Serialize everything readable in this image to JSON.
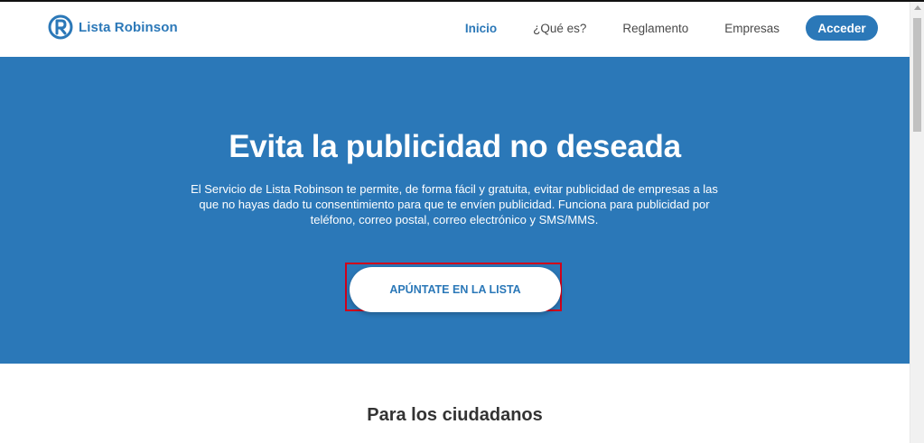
{
  "brand": {
    "name": "Lista Robinson",
    "color": "#2b78b8"
  },
  "nav": {
    "items": [
      {
        "label": "Inicio",
        "active": true
      },
      {
        "label": "¿Qué es?",
        "active": false
      },
      {
        "label": "Reglamento",
        "active": false
      },
      {
        "label": "Empresas",
        "active": false
      }
    ],
    "login_label": "Acceder"
  },
  "hero": {
    "title": "Evita la publicidad no deseada",
    "description": "El Servicio de Lista Robinson te permite, de forma fácil y gratuita, evitar publicidad de empresas a las que no hayas dado tu consentimiento para que te envíen publicidad. Funciona para publicidad por teléfono, correo postal, correo electrónico y SMS/MMS.",
    "cta_label": "APÚNTATE EN LA LISTA",
    "background": "#2b78b8",
    "highlight_color": "#d0021b"
  },
  "section": {
    "title": "Para los ciudadanos"
  }
}
